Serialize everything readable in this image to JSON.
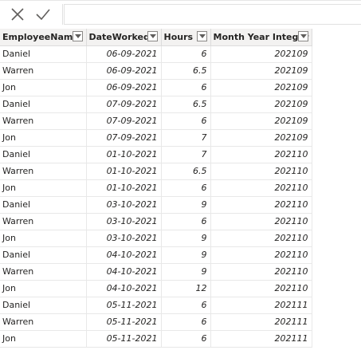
{
  "toolbar": {
    "cancel_icon": "close-icon",
    "commit_icon": "check-icon",
    "formula_value": ""
  },
  "table": {
    "columns": [
      {
        "label": "EmployeeName",
        "align": "left"
      },
      {
        "label": "DateWorked",
        "align": "right"
      },
      {
        "label": "Hours",
        "align": "right"
      },
      {
        "label": "Month Year Integer",
        "align": "right"
      }
    ],
    "rows": [
      [
        "Daniel",
        "06-09-2021",
        "6",
        "202109"
      ],
      [
        "Warren",
        "06-09-2021",
        "6.5",
        "202109"
      ],
      [
        "Jon",
        "06-09-2021",
        "6",
        "202109"
      ],
      [
        "Daniel",
        "07-09-2021",
        "6.5",
        "202109"
      ],
      [
        "Warren",
        "07-09-2021",
        "6",
        "202109"
      ],
      [
        "Jon",
        "07-09-2021",
        "7",
        "202109"
      ],
      [
        "Daniel",
        "01-10-2021",
        "7",
        "202110"
      ],
      [
        "Warren",
        "01-10-2021",
        "6.5",
        "202110"
      ],
      [
        "Jon",
        "01-10-2021",
        "6",
        "202110"
      ],
      [
        "Daniel",
        "03-10-2021",
        "9",
        "202110"
      ],
      [
        "Warren",
        "03-10-2021",
        "6",
        "202110"
      ],
      [
        "Jon",
        "03-10-2021",
        "9",
        "202110"
      ],
      [
        "Daniel",
        "04-10-2021",
        "9",
        "202110"
      ],
      [
        "Warren",
        "04-10-2021",
        "9",
        "202110"
      ],
      [
        "Jon",
        "04-10-2021",
        "12",
        "202110"
      ],
      [
        "Daniel",
        "05-11-2021",
        "6",
        "202111"
      ],
      [
        "Warren",
        "05-11-2021",
        "6",
        "202111"
      ],
      [
        "Jon",
        "05-11-2021",
        "6",
        "202111"
      ]
    ]
  },
  "colors": {
    "header_bg": "#f3f2f1",
    "text": "#252423",
    "grid_line": "#e8e8e8"
  }
}
